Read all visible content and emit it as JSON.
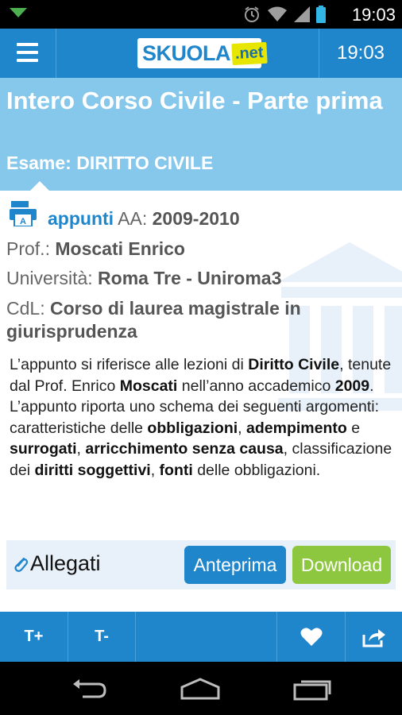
{
  "status_bar": {
    "time": "19:03"
  },
  "app_bar": {
    "logo_main": "SKUOLA",
    "logo_suffix": ".net",
    "time": "19:03"
  },
  "header": {
    "title": "Intero Corso Civile - Parte prima",
    "exam": "Esame: DIRITTO CIVILE"
  },
  "info": {
    "type": "appunti",
    "year_label": "AA:",
    "year": "2009-2010",
    "prof_label": "Prof.:",
    "prof": "Moscati Enrico",
    "uni_label": "Università:",
    "uni": "Roma Tre - Uniroma3",
    "cdl_label": "CdL:",
    "cdl": "Corso di laurea magistrale in giurisprudenza"
  },
  "description": {
    "p1": "L’appunto si riferisce alle lezioni di ",
    "b1": "Diritto Civile",
    "p2": ", tenute dal Prof. Enrico ",
    "b2": "Moscati",
    "p3": " nell’anno accademico ",
    "b3": "2009",
    "p4": ".",
    "p5": "L’appunto riporta uno schema dei seguenti argomenti: caratteristiche delle ",
    "b5": "obbligazioni",
    "p6": ", ",
    "b6": "adempimento",
    "p7": " e ",
    "b7": "surrogati",
    "p8": ", ",
    "b8": "arricchimento senza causa",
    "p9": ", classificazione dei ",
    "b9": "diritti soggettivi",
    "p10": ", ",
    "b10": "fonti",
    "p11": " delle obbligazioni."
  },
  "attachments": {
    "label": "Allegati",
    "preview_button": "Anteprima",
    "download_button": "Download"
  },
  "bottom_bar": {
    "text_increase": "T+",
    "text_decrease": "T-"
  },
  "colors": {
    "primary": "#1f86cc",
    "header_bg": "#86c7ec",
    "download": "#8dc63f",
    "attachments_bg": "#e8f1f9"
  }
}
